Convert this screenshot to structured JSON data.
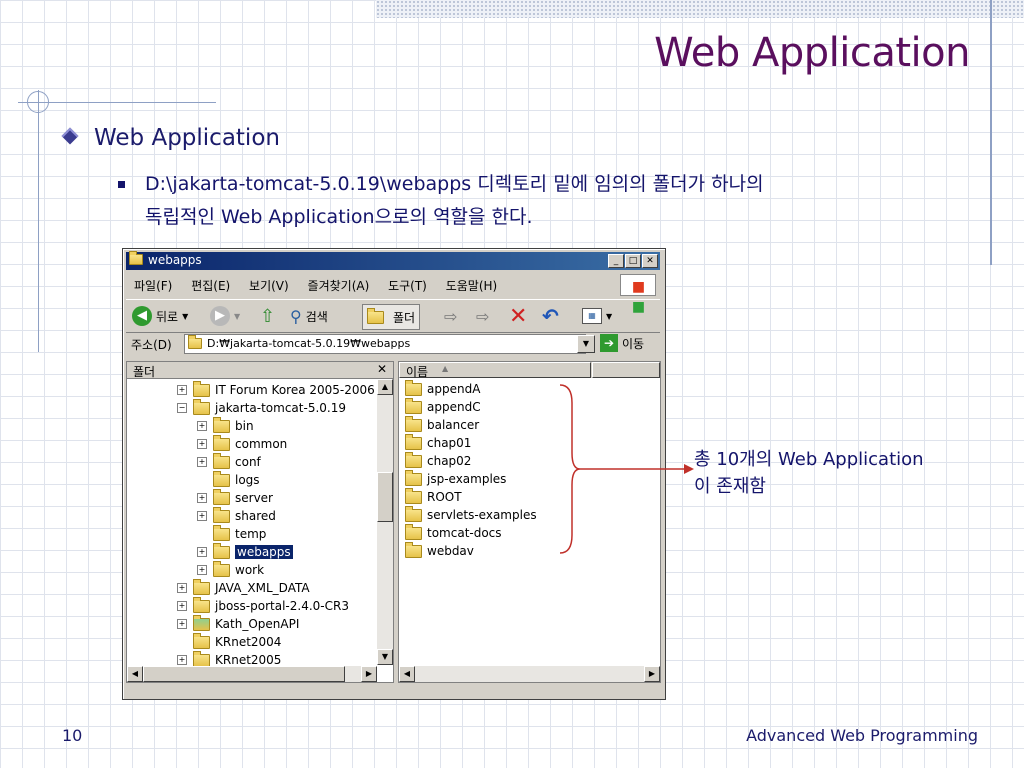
{
  "slide": {
    "title": "Web Application",
    "bullet1": "Web Application",
    "bullet2_line1": "D:\\jakarta-tomcat-5.0.19\\webapps 디렉토리 밑에 임의의 폴더가 하나의",
    "bullet2_line2": "독립적인 Web Application으로의 역할을 한다.",
    "annotation_line1": "총 10개의 Web Application",
    "annotation_line2": "이 존재함",
    "page_number": "10",
    "footer": "Advanced Web Programming",
    "arrow_color": "#c0302a"
  },
  "window": {
    "title": "webapps",
    "menu": [
      "파일(F)",
      "편집(E)",
      "보기(V)",
      "즐겨찾기(A)",
      "도구(T)",
      "도움말(H)"
    ],
    "toolbar": {
      "back": "뒤로",
      "search": "검색",
      "folders": "폴더"
    },
    "address_label": "주소(D)",
    "address_value": "D:₩jakarta-tomcat-5.0.19₩webapps",
    "go_label": "이동",
    "folder_pane_label": "폴더",
    "name_column": "이름",
    "tree": [
      {
        "label": "IT Forum Korea 2005-2006",
        "expander": "+"
      },
      {
        "label": "jakarta-tomcat-5.0.19",
        "expander": "−"
      },
      {
        "label": "bin",
        "expander": "+"
      },
      {
        "label": "common",
        "expander": "+"
      },
      {
        "label": "conf",
        "expander": "+"
      },
      {
        "label": "logs",
        "expander": ""
      },
      {
        "label": "server",
        "expander": "+"
      },
      {
        "label": "shared",
        "expander": "+"
      },
      {
        "label": "temp",
        "expander": ""
      },
      {
        "label": "webapps",
        "expander": "+"
      },
      {
        "label": "work",
        "expander": "+"
      },
      {
        "label": "JAVA_XML_DATA",
        "expander": "+"
      },
      {
        "label": "jboss-portal-2.4.0-CR3",
        "expander": "+"
      },
      {
        "label": "Kath_OpenAPI",
        "expander": "+"
      },
      {
        "label": "KRnet2004",
        "expander": ""
      },
      {
        "label": "KRnet2005",
        "expander": "+"
      }
    ],
    "files": [
      "appendA",
      "appendC",
      "balancer",
      "chap01",
      "chap02",
      "jsp-examples",
      "ROOT",
      "servlets-examples",
      "tomcat-docs",
      "webdav"
    ]
  }
}
